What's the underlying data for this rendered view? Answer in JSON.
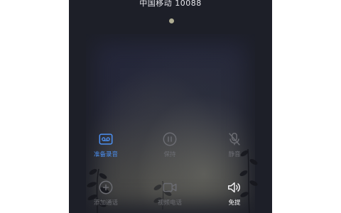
{
  "call": {
    "title": "中国移动 10088"
  },
  "controls": [
    {
      "id": "record",
      "label": "准备录音",
      "icon": "record-icon",
      "state": "active"
    },
    {
      "id": "hold",
      "label": "保持",
      "icon": "pause-icon",
      "state": "disabled"
    },
    {
      "id": "mute",
      "label": "静音",
      "icon": "mic-off-icon",
      "state": "disabled"
    },
    {
      "id": "add",
      "label": "添加通话",
      "icon": "plus-circle-icon",
      "state": "disabled"
    },
    {
      "id": "video",
      "label": "视频电话",
      "icon": "video-icon",
      "state": "disabled"
    },
    {
      "id": "speaker",
      "label": "免提",
      "icon": "speaker-icon",
      "state": "enabled"
    }
  ],
  "colors": {
    "active": "#4b8ff0",
    "disabled": "#6b6c72",
    "enabled": "#f2f2f4",
    "background": "#1d1f28"
  }
}
